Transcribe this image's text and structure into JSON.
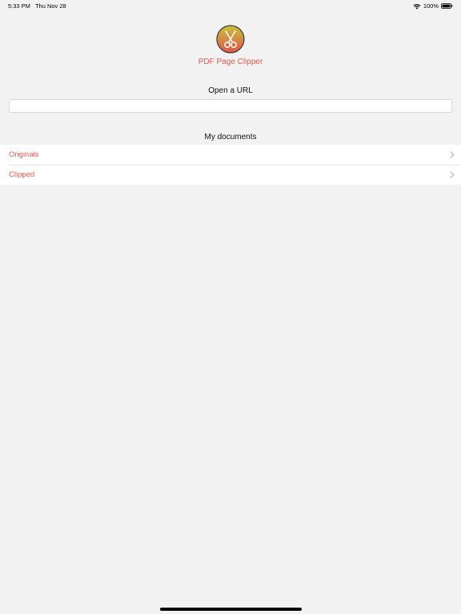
{
  "status_bar": {
    "time": "5:33 PM",
    "date": "Thu Nov 28",
    "battery": "100%",
    "icons": [
      "wifi-icon",
      "battery-icon"
    ]
  },
  "header": {
    "app_title": "PDF Page Clipper",
    "logo_icon": "scissors-icon",
    "logo_colors": [
      "#c9c13a",
      "#e0564a"
    ]
  },
  "url_section": {
    "title": "Open a URL",
    "input_value": "",
    "placeholder": ""
  },
  "documents_section": {
    "title": "My documents",
    "items": [
      {
        "label": "Originals",
        "icon": "chevron-right-icon"
      },
      {
        "label": "Clipped",
        "icon": "chevron-right-icon"
      }
    ]
  },
  "theme": {
    "accent": "#e8574f",
    "background": "#f2f2f2"
  }
}
